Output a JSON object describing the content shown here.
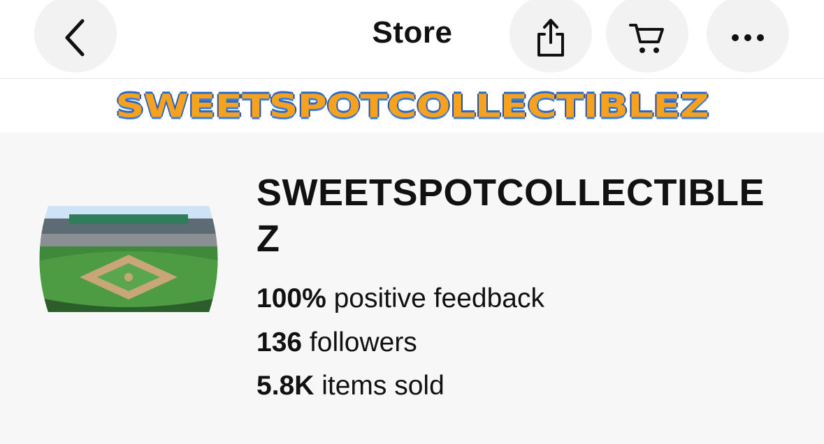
{
  "header": {
    "title": "Store",
    "back_icon": "chevron-left-icon",
    "share_icon": "share-icon",
    "cart_icon": "cart-icon",
    "more_icon": "more-horizontal-icon"
  },
  "banner": {
    "text": "SWEETSPOTCOLLECTIBLEZ"
  },
  "store": {
    "name": "SWEETSPOTCOLLECTIBLEZ",
    "avatar_icon": "baseball-stadium-image",
    "stats": [
      {
        "value": "100%",
        "label": "positive feedback"
      },
      {
        "value": "136",
        "label": "followers"
      },
      {
        "value": "5.8K",
        "label": "items sold"
      }
    ]
  },
  "colors": {
    "banner_orange": "#f6a21e",
    "banner_blue": "#2a68c8",
    "button_bg": "#f2f2f2",
    "panel_bg": "#f7f7f7"
  }
}
